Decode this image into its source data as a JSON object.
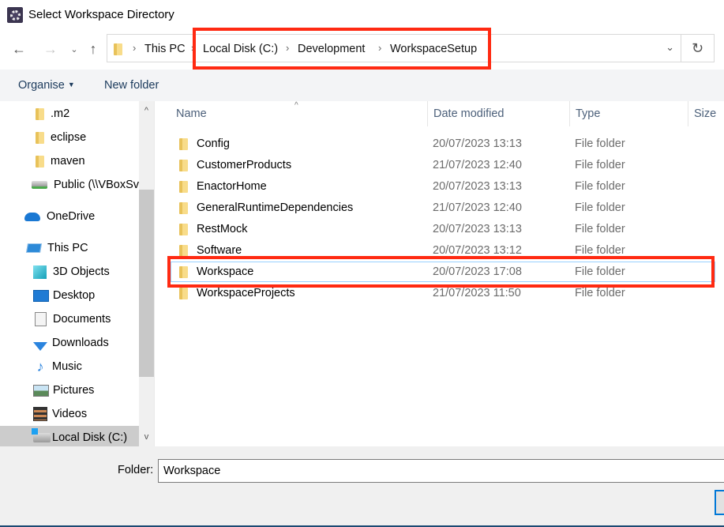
{
  "window": {
    "title": "Select Workspace Directory",
    "app_icon": "eclipse-gear-icon"
  },
  "navigation": {
    "back_icon": "arrow-left-icon",
    "forward_icon": "arrow-right-icon",
    "recent_icon": "chevron-down-icon",
    "up_icon": "arrow-up-icon",
    "back_glyph": "←",
    "forward_glyph": "→",
    "recent_glyph": "⌄",
    "up_glyph": "↑",
    "breadcrumb": [
      "This PC",
      "Local Disk (C:)",
      "Development",
      "WorkspaceSetup"
    ],
    "separator": "›",
    "dropdown_glyph": "⌄",
    "refresh_glyph": "↻"
  },
  "toolbar": {
    "organise_label": "Organise",
    "organise_caret": "▼",
    "new_folder_label": "New folder"
  },
  "sidebar": {
    "items": [
      {
        "label": ".m2",
        "icon": "folder-icon"
      },
      {
        "label": "eclipse",
        "icon": "folder-icon"
      },
      {
        "label": "maven",
        "icon": "folder-icon"
      },
      {
        "label": "Public (\\\\VBoxSvr)",
        "icon": "network-drive-icon"
      },
      {
        "label": "OneDrive",
        "icon": "onedrive-cloud-icon"
      },
      {
        "label": "This PC",
        "icon": "this-pc-icon"
      },
      {
        "label": "3D Objects",
        "icon": "3d-objects-icon"
      },
      {
        "label": "Desktop",
        "icon": "desktop-icon"
      },
      {
        "label": "Documents",
        "icon": "documents-icon"
      },
      {
        "label": "Downloads",
        "icon": "downloads-icon"
      },
      {
        "label": "Music",
        "icon": "music-icon"
      },
      {
        "label": "Pictures",
        "icon": "pictures-icon"
      },
      {
        "label": "Videos",
        "icon": "videos-icon"
      },
      {
        "label": "Local Disk (C:)",
        "icon": "local-disk-icon",
        "selected": true
      }
    ],
    "scroll_up_glyph": "^",
    "scroll_down_glyph": "v",
    "music_glyph": "♪"
  },
  "filelist": {
    "columns": [
      "Name",
      "Date modified",
      "Type",
      "Size"
    ],
    "sort_glyph": "^",
    "rows": [
      {
        "name": "Config",
        "date": "20/07/2023 13:13",
        "type": "File folder"
      },
      {
        "name": "CustomerProducts",
        "date": "21/07/2023 12:40",
        "type": "File folder"
      },
      {
        "name": "EnactorHome",
        "date": "20/07/2023 13:13",
        "type": "File folder"
      },
      {
        "name": "GeneralRuntimeDependencies",
        "date": "21/07/2023 12:40",
        "type": "File folder"
      },
      {
        "name": "RestMock",
        "date": "20/07/2023 13:13",
        "type": "File folder"
      },
      {
        "name": "Software",
        "date": "20/07/2023 13:12",
        "type": "File folder"
      },
      {
        "name": "Workspace",
        "date": "20/07/2023 17:08",
        "type": "File folder",
        "focused": true
      },
      {
        "name": "WorkspaceProjects",
        "date": "21/07/2023 11:50",
        "type": "File folder"
      }
    ]
  },
  "footer": {
    "folder_label": "Folder:",
    "folder_value": "Workspace"
  },
  "annotations": {
    "highlight_color": "#ff2a12"
  }
}
